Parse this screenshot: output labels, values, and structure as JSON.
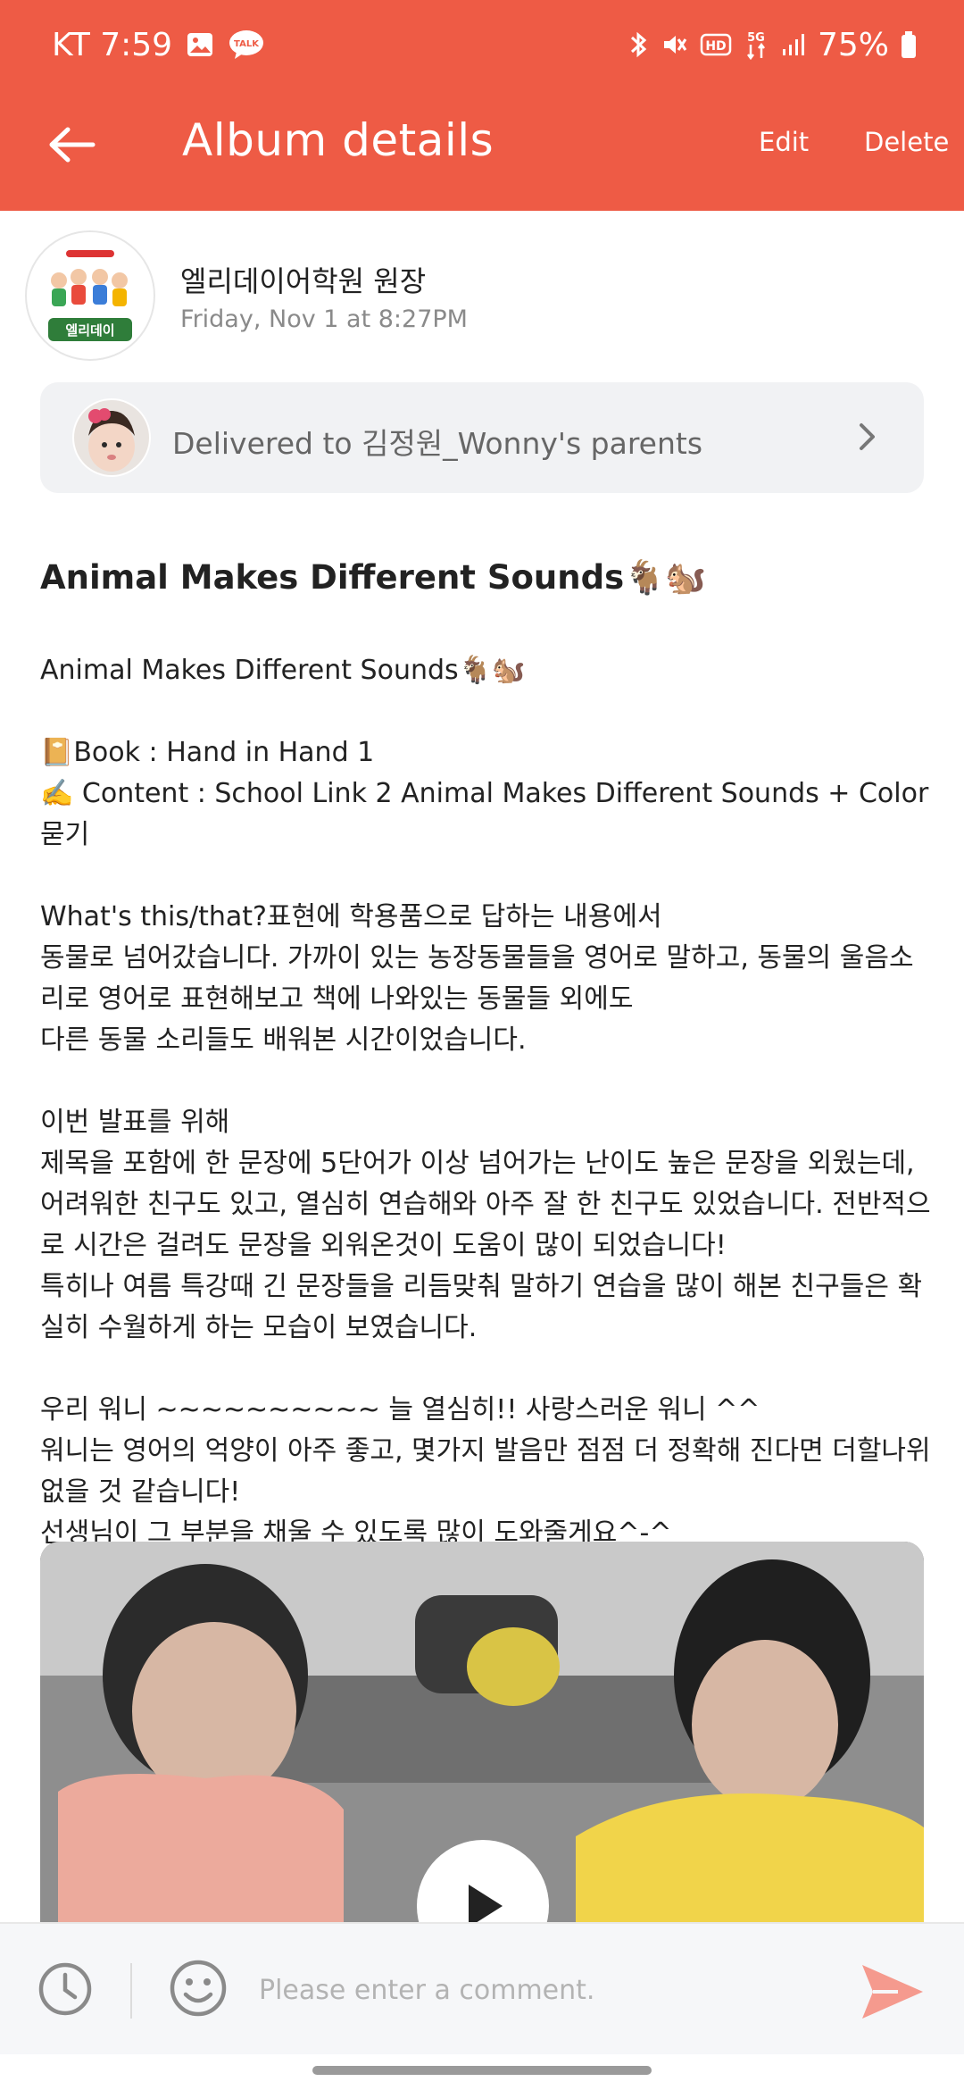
{
  "status_bar": {
    "carrier_time": "KT 7:59",
    "battery": "75%",
    "network": "5G"
  },
  "header": {
    "title": "Album details",
    "edit_label": "Edit",
    "delete_label": "Delete",
    "background_color": "#ee5b45"
  },
  "author": {
    "name": "엘리데이어학원 원장",
    "date": "Friday, Nov 1 at 8:27PM",
    "logo_text": "엘리데이"
  },
  "delivered": {
    "text": "Delivered to 김정원_Wonny's parents"
  },
  "post": {
    "title": "Animal Makes Different Sounds🐐🐿️",
    "body": "Animal Makes Different Sounds🐐🐿️\n\n📔Book : Hand in Hand 1\n✍️ Content : School Link 2 Animal Makes Different Sounds + Color 묻기\n\nWhat's this/that?표현에 학용품으로 답하는 내용에서\n동물로 넘어갔습니다. 가까이 있는 농장동물들을 영어로 말하고, 동물의 울음소리로 영어로 표현해보고 책에 나와있는 동물들 외에도\n다른 동물 소리들도 배워본 시간이었습니다.\n\n이번 발표를 위해\n제목을 포함에 한 문장에 5단어가 이상 넘어가는 난이도 높은 문장을 외웠는데, 어려워한 친구도 있고, 열심히 연습해와 아주 잘 한 친구도 있었습니다. 전반적으로 시간은 걸려도 문장을 외워온것이 도움이 많이 되었습니다!\n특히나 여름 특강때 긴 문장들을 리듬맞춰 말하기 연습을 많이 해본 친구들은 확실히 수월하게 하는 모습이 보였습니다.\n\n우리 워니 ~~~~~~~~~~ 늘 열심히!! 사랑스러운 워니 ^^\n워니는 영어의 억양이 아주 좋고, 몇가지 발음만 점점 더 정확해 진다면 더할나위없을 것 같습니다!\n선생님이 그 부분을 채울 수 있도록 많이 도와줄게요^-^"
  },
  "comment": {
    "placeholder": "Please enter a comment."
  }
}
